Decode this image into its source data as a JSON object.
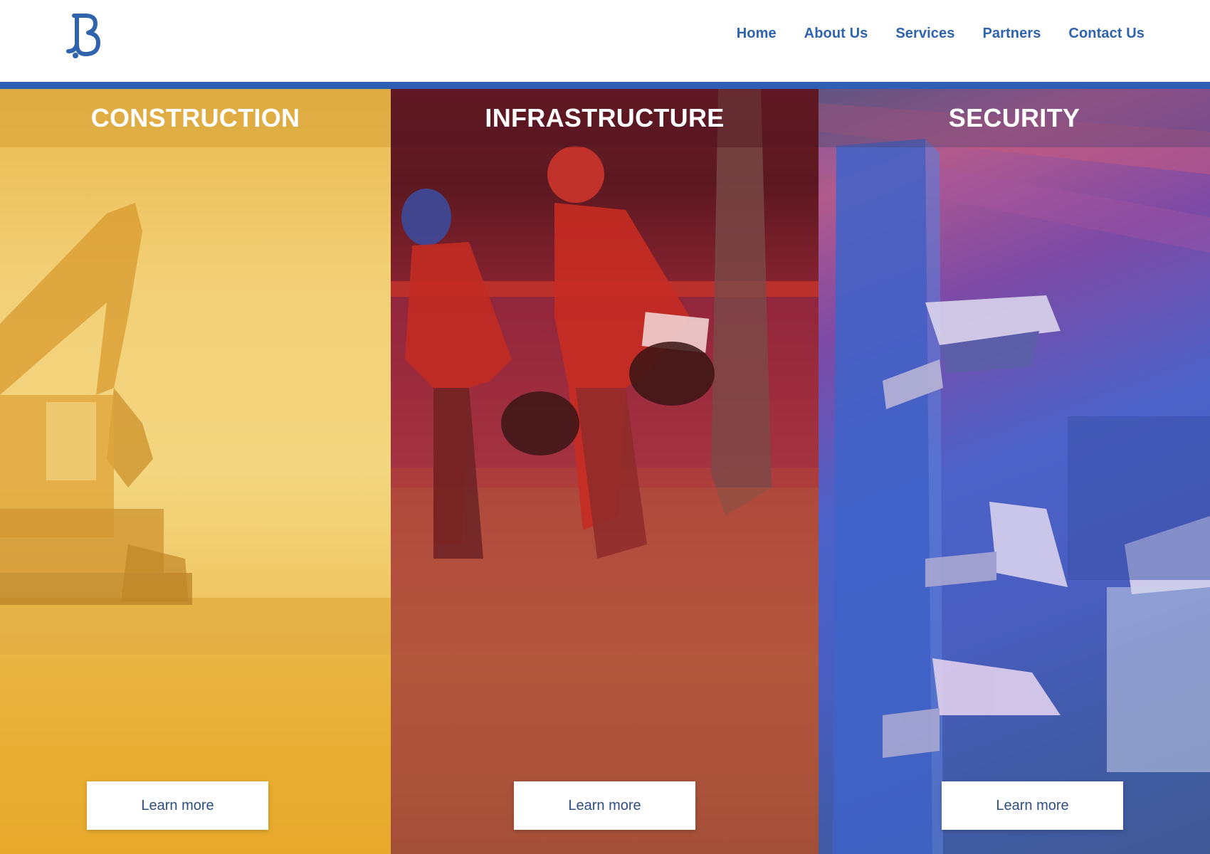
{
  "brand": {
    "logo_icon": "b-logo-icon",
    "color": "#2f63ad"
  },
  "nav": {
    "items": [
      {
        "label": "Home"
      },
      {
        "label": "About Us"
      },
      {
        "label": "Services"
      },
      {
        "label": "Partners"
      },
      {
        "label": "Contact Us"
      }
    ]
  },
  "accent_rule_color": "#2f5fb5",
  "panels": [
    {
      "title": "CONSTRUCTION",
      "button": "Learn more",
      "tint": "#f0c25a",
      "image": "excavator-image"
    },
    {
      "title": "INFRASTRUCTURE",
      "button": "Learn more",
      "tint": "#a83539",
      "image": "workers-image"
    },
    {
      "title": "SECURITY",
      "button": "Learn more",
      "tint": "#4a5ec1",
      "image": "cctv-cameras-image"
    }
  ]
}
